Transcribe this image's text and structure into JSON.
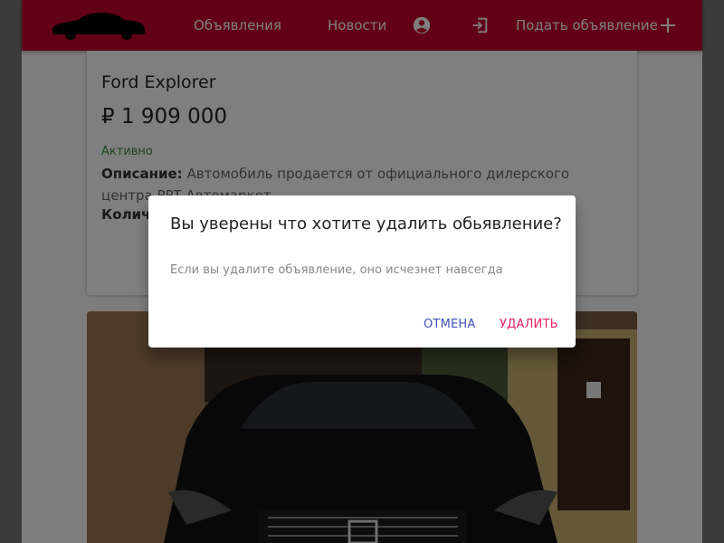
{
  "navbar": {
    "links": {
      "ads": "Объявления",
      "news": "Новости"
    },
    "post_label": "Подать объявление",
    "icons": [
      "car-logo",
      "account-circle-icon",
      "login-icon",
      "plus-icon"
    ],
    "color": "#c2002e"
  },
  "listing": {
    "title": "Ford Explorer",
    "price": "₽ 1 909 000",
    "status": "Активно",
    "description_label": "Описание:",
    "description": "Автомобиль продается от официального дилерского центра РРТ Автомаркет",
    "quantity_label": "Количе"
  },
  "dialog": {
    "title": "Вы уверены что хотите удалить обьявление?",
    "text": "Если вы удалите объявление, оно исчезнет навсегда",
    "cancel_label": "Отмена",
    "delete_label": "Удалить"
  }
}
